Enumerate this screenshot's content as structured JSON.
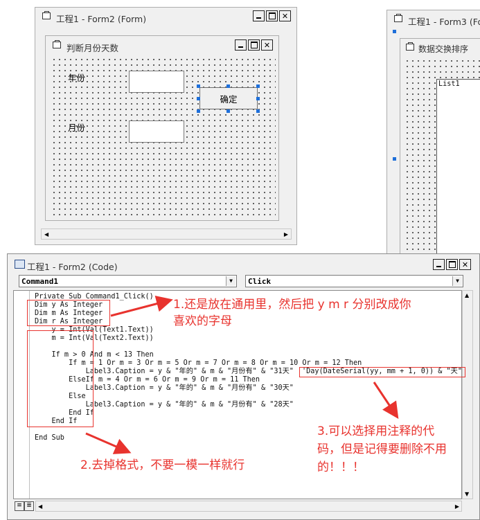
{
  "form2_window": {
    "title": "工程1 - Form2 (Form)"
  },
  "form2_inner": {
    "title": "判断月份天数"
  },
  "form2_labels": {
    "year": "年份",
    "month": "月份"
  },
  "form2_button": {
    "label": "确定"
  },
  "form3_window": {
    "title": "工程1 - Form3 (Fo"
  },
  "form3_inner": {
    "title": "数据交换排序"
  },
  "form3_list": {
    "label": "List1"
  },
  "code_window": {
    "title": "工程1 - Form2 (Code)",
    "object_combo": "Command1",
    "proc_combo": "Click"
  },
  "code_lines": [
    "Private Sub Command1_Click()",
    "Dim y As Integer",
    "Dim m As Integer",
    "Dim r As Integer",
    "    y = Int(Val(Text1.Text))",
    "    m = Int(Val(Text2.Text))",
    "",
    "    If m > 0 And m < 13 Then",
    "        If m = 1 Or m = 3 Or m = 5 Or m = 7 Or m = 8 Or m = 10 Or m = 12 Then",
    "            Label3.Caption = y & \"年的\" & m & \"月份有\" & \"31天\"",
    "        ElseIf m = 4 Or m = 6 Or m = 9 Or m = 11 Then",
    "            Label3.Caption = y & \"年的\" & m & \"月份有\" & \"30天\"",
    "        Else",
    "            Label3.Caption = y & \"年的\" & m & \"月份有\" & \"28天\"",
    "        End If",
    "    End If",
    "",
    "End Sub"
  ],
  "comment_code": "'Day(DateSerial(yy, mm + 1, 0)) & \"天\"",
  "annotations": {
    "note1_line1": "1.还是放在通用里，然后把 y m r 分别改成你",
    "note1_line2": "喜欢的字母",
    "note2": "2.去掉格式，不要一模一样就行",
    "note3_line1": "3.可以选择用注释的代",
    "note3_line2": "码，但是记得要删除不用",
    "note3_line3": "的！！！"
  },
  "colors": {
    "annotation_red": "#e8332e",
    "selection_handle": "#1e6fd9"
  }
}
